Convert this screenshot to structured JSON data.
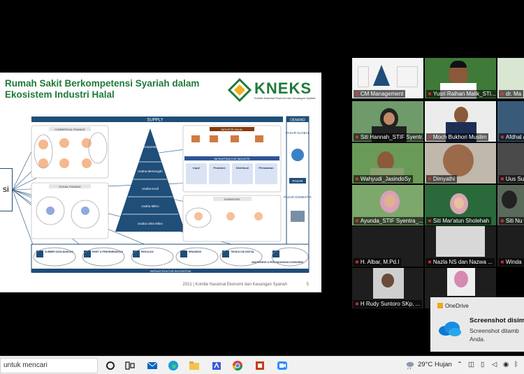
{
  "slide": {
    "title_line1": "Rumah Sakit Berkompetensi Syariah dalam",
    "title_line2": "Ekosistem Industri Halal",
    "logo_text": "KNEKS",
    "logo_subtitle": "Komite Nasional Ekonomi dan Keuangan Syariah",
    "footer_org": "2021 | Komite Nasional Ekonomi dan Keuangan Syariah",
    "page_number": "5",
    "callout_text": "si",
    "diagram": {
      "supply": "SUPPLY",
      "demand": "DEMAND",
      "commercial_finance": "COMMERCIAL FINANCE",
      "social_finance": "SOCIAL FINANCE",
      "industri_halal": "INDUSTRI HALAL",
      "infrastruktur_industri": "INFRASTRUKTUR INDUSTRI",
      "komunitas": "KOMUNITAS",
      "infrastruktur_ekosistem": "INFRASTRUKTUR EKOSISTEM",
      "pyramid": [
        "Korporasi",
        "Usaha Menengah",
        "Usaha Kecil",
        "Usaha Mikro",
        "Usaha Ultra Mikro"
      ],
      "pasar_global": "PASAR GLOBAL",
      "pasar": "PASAR",
      "pasar_domestik": "PASAR DOMESTIK",
      "chain": [
        "Input",
        "Produksi",
        "Distribusi",
        "Pemasaran"
      ],
      "bottom_items": [
        "SUMBER DAYA MANUSIA",
        "RISET & PENGEMBANGAN",
        "REGULASI",
        "BRANDING",
        "TEKNOLOGI DIGITAL",
        "AWARENESS & PERLINDUNGAN KONSUMEN"
      ]
    }
  },
  "participants": [
    {
      "name": "CM Management",
      "active": true
    },
    {
      "name": "Yusri Raihan Malik_STI..."
    },
    {
      "name": "dr. Ma"
    },
    {
      "name": "Siti Hannah_STIF Syentr..."
    },
    {
      "name": "Moch Bukhori Muslim"
    },
    {
      "name": "Afdhal Ali"
    },
    {
      "name": "Wahyudi_JasindoSy"
    },
    {
      "name": "Dimyathi"
    },
    {
      "name": "Uus Su"
    },
    {
      "name": "Ayunda_STIF Syentra_..."
    },
    {
      "name": "Siti Mar'atun Sholehah"
    },
    {
      "name": "Siti Nu"
    },
    {
      "name": "H. Albar, M.Pd.I"
    },
    {
      "name": "Nazla NS dan Nazwa ..."
    },
    {
      "name": "Winda"
    },
    {
      "name": "H Rudy Suntoro SKp, ..."
    }
  ],
  "notification": {
    "app": "OneDrive",
    "title": "Screenshot disimp",
    "body_line1": "Screenshot ditamb",
    "body_line2": "Anda."
  },
  "taskbar": {
    "search_placeholder": "untuk mencari",
    "temperature": "29°C",
    "weather": "Hujan"
  },
  "colors": {
    "slide_green": "#1f7a3a",
    "pyramid_blue": "#1f4e79",
    "active_speaker": "#f2d648"
  }
}
